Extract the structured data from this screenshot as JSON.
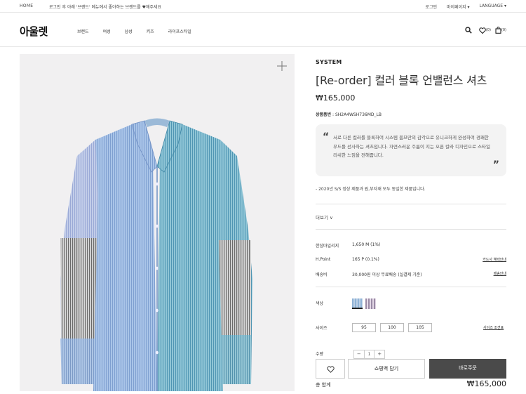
{
  "topbar": {
    "home": "HOME",
    "notice": "로그인 후 아래 '브랜드' 메뉴에서 좋아하는 브랜드를 ♥해주세요",
    "login": "로그인",
    "mypage": "마이페이지",
    "language": "LANGUAGE"
  },
  "header": {
    "logo": "아울렛",
    "nav": [
      "브랜드",
      "여성",
      "남성",
      "키즈",
      "라이프스타일"
    ],
    "wish_count": "(0)",
    "cart_count": "(0)"
  },
  "product": {
    "brand": "SYSTEM",
    "name": "[Re-order] 컬러 블록 언밸런스 셔츠",
    "price": "₩165,000",
    "code_label": "상품품번",
    "code_value": ": SH2A4WSH736MD_LB",
    "description": "서로 다른 컬러를 블록하여 시스템 옴므만의 감각으로 유니크하게 완성하여 경쾌한 무드를 선사하는 셔츠입니다. 자연스러운 주름이 지는 오픈 칼라 디자인으로 스타일리쉬한 느낌을 전해줍니다.",
    "note": "- 2020년 S/S 정상 제품과 원,부자재 모두 동일한 제품입니다.",
    "more": "더보기 ∨"
  },
  "benefits": [
    {
      "label": "한섬마일리지",
      "value": "1,650 M (1%)",
      "link": ""
    },
    {
      "label": "H.Point",
      "value": "165 P (0.1%)",
      "link": "카드사 혜택안내"
    },
    {
      "label": "배송비",
      "value": "30,000원 이상 무료배송 (실결제 기준)",
      "link": "배송안내"
    }
  ],
  "options": {
    "color_label": "색상",
    "size_label": "사이즈",
    "sizes": [
      "95",
      "100",
      "105"
    ],
    "size_guide": "사이즈 조견표",
    "qty_label": "수량",
    "qty_value": "1",
    "minus": "−",
    "plus": "+",
    "swatch_colors": [
      "#8fb3d6",
      "#c9b4c9"
    ]
  },
  "actions": {
    "cart": "쇼핑백 담기",
    "buy": "바로주문"
  },
  "total": {
    "label": "총 합계",
    "value": "₩165,000"
  }
}
